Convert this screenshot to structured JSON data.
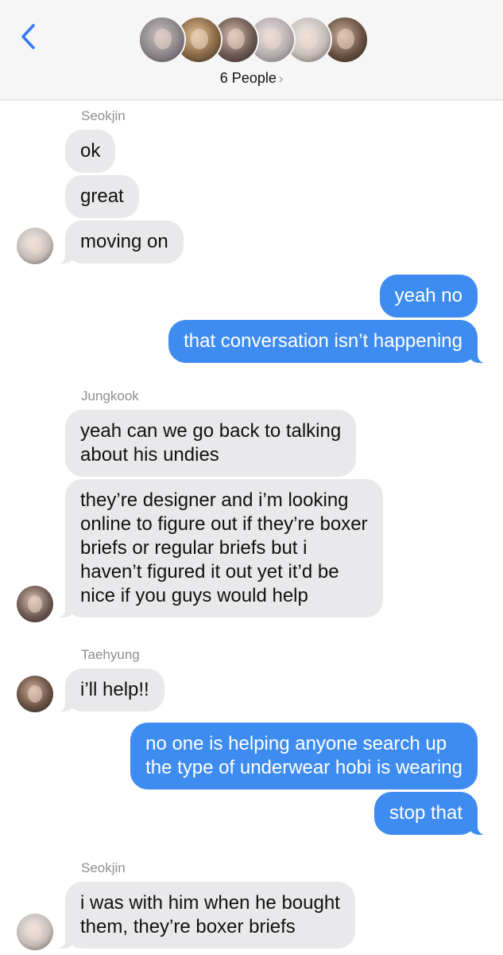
{
  "header": {
    "people_label": "6 People",
    "chevron": "›",
    "avatars": [
      "person-1",
      "person-2",
      "person-3",
      "person-4",
      "person-5",
      "person-6"
    ]
  },
  "messages": {
    "m1": {
      "sender": "Seokjin",
      "lines": [
        "ok",
        "great",
        "moving on"
      ]
    },
    "m2": {
      "lines": [
        "yeah no",
        "that conversation isn’t happening"
      ]
    },
    "m3": {
      "sender": "Jungkook",
      "b1": [
        "yeah can we go back to talking",
        "about his undies"
      ],
      "b2": [
        "they’re designer and i’m looking",
        "online to figure out if they’re boxer",
        "briefs or regular briefs but i",
        "haven’t figured it out yet it’d be",
        "nice if you guys would help"
      ]
    },
    "m4": {
      "sender": "Taehyung",
      "lines": [
        "i’ll help!!"
      ]
    },
    "m5": {
      "b1": [
        "no one is helping anyone search up",
        "the type of underwear hobi is wearing"
      ],
      "b2": [
        "stop that"
      ]
    },
    "m6": {
      "sender": "Seokjin",
      "b1": [
        "i was with him when he bought",
        "them, they’re boxer briefs"
      ]
    }
  },
  "colors": {
    "outgoing": "#3f8cf1",
    "incoming": "#e9e9eb",
    "header_bg": "#f6f6f6",
    "accent": "#3478f6"
  }
}
